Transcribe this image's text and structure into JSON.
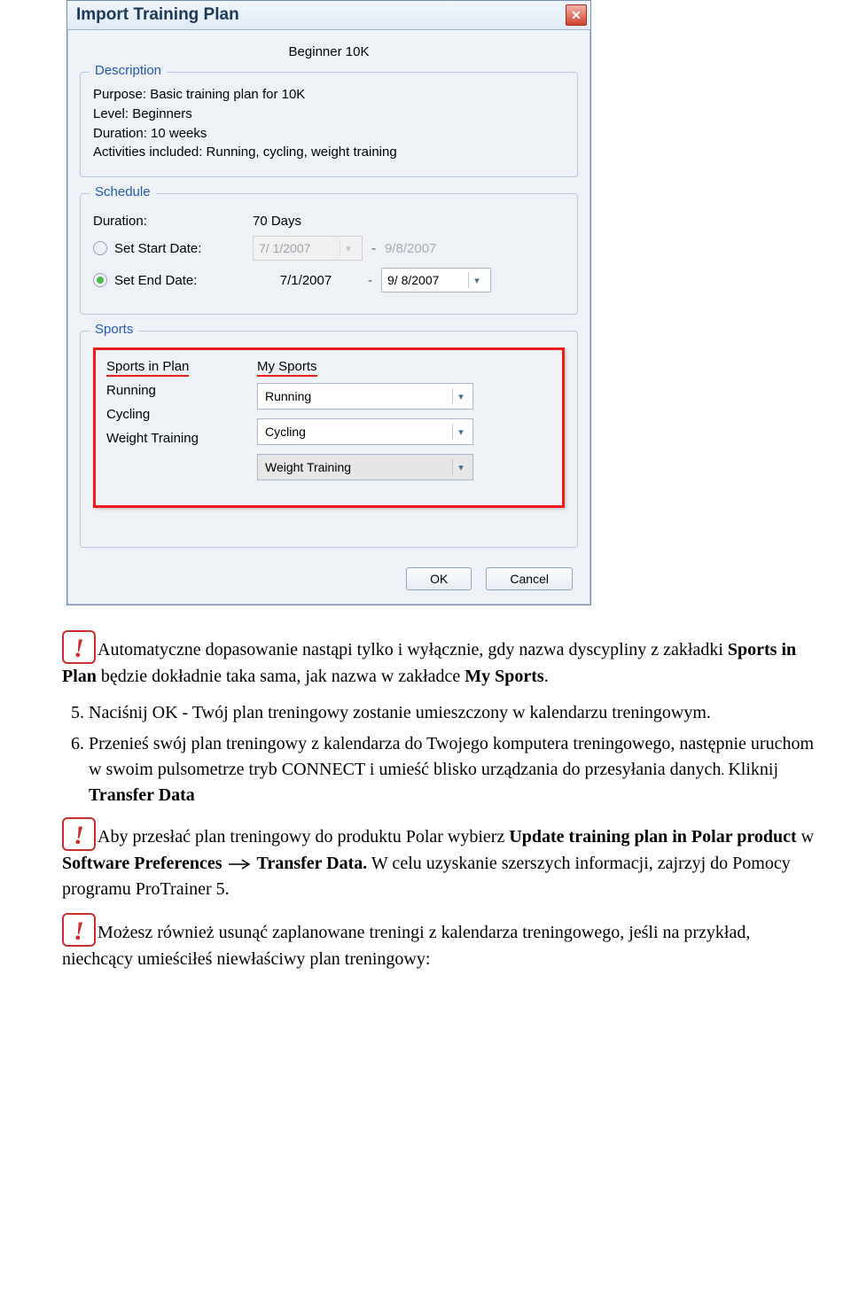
{
  "dialog": {
    "title": "Import Training Plan",
    "close_icon_label": "✕",
    "subtitle": "Beginner 10K",
    "description": {
      "legend": "Description",
      "lines": [
        "Purpose: Basic training plan for 10K",
        "Level: Beginners",
        "Duration: 10 weeks",
        "Activities included: Running, cycling, weight training"
      ]
    },
    "schedule": {
      "legend": "Schedule",
      "duration_label": "Duration:",
      "duration_value": "70  Days",
      "start_label": "Set Start Date:",
      "start_value": "7/ 1/2007",
      "start_end_ghost": "9/8/2007",
      "end_label": "Set End Date:",
      "end_start_text": "7/1/2007",
      "end_value": "9/ 8/2007",
      "dash": "-"
    },
    "sports": {
      "legend": "Sports",
      "header_plan": "Sports in Plan",
      "header_my": "My Sports",
      "rows": [
        {
          "plan": "Running",
          "my": "Running"
        },
        {
          "plan": "Cycling",
          "my": "Cycling"
        },
        {
          "plan": "Weight Training",
          "my": "Weight Training"
        }
      ]
    },
    "buttons": {
      "ok": "OK",
      "cancel": "Cancel"
    }
  },
  "doc": {
    "note1_a": "Automatyczne dopasowanie nastąpi tylko i wyłącznie, gdy nazwa dyscypliny z zakładki ",
    "note1_b1": "Sports in Plan",
    "note1_c": " będzie dokładnie taka sama, jak nazwa w zakładce ",
    "note1_b2": "My Sports",
    "note1_d": ".",
    "li5": "Naciśnij OK - Twój plan treningowy zostanie umieszczony w kalendarzu treningowym.",
    "li6_a": "Przenieś swój plan treningowy z kalendarza do Twojego komputera treningowego, następnie uruchom w swoim pulsometrze tryb CONNECT i umieść blisko urządzania do przesyłania danych",
    "li6_dot": ". ",
    "li6_b": "Kliknij ",
    "li6_bold": "Transfer Data",
    "note2_a": "Aby przesłać plan treningowy do produktu Polar wybierz ",
    "note2_b1": "Update training plan in Polar product",
    "note2_c": " w ",
    "note2_b2": "Software Preferences",
    "note2_d": " ",
    "note2_b3": "Transfer Data.",
    "note2_e": " W celu uzyskanie szerszych informacji, zajrzyj do Pomocy programu ProTrainer 5.",
    "note3": "Możesz również usunąć zaplanowane treningi z kalendarza treningowego, jeśli na przykład, niechcący umieściłeś niewłaściwy plan treningowy:"
  }
}
